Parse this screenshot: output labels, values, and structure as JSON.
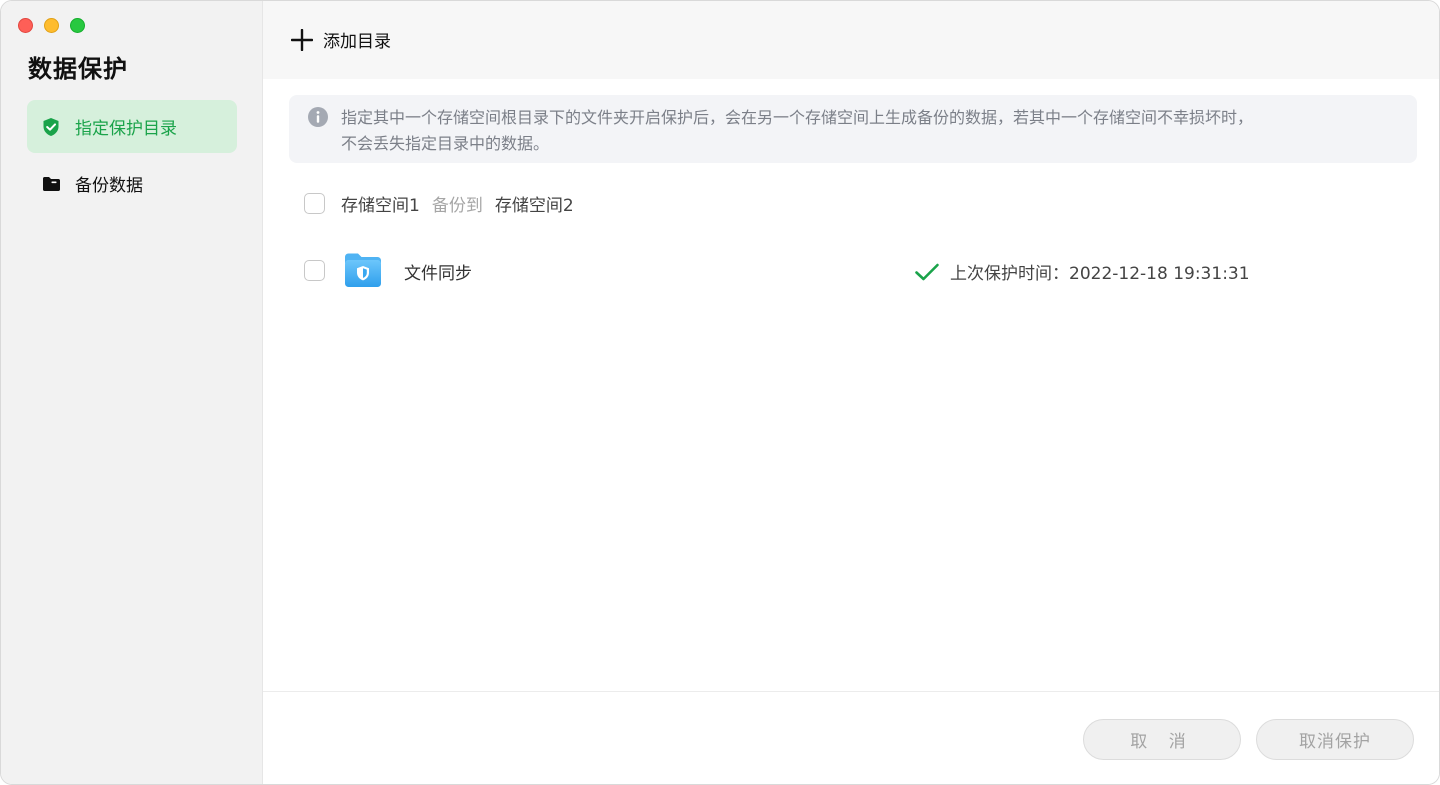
{
  "sidebar": {
    "title": "数据保护",
    "items": [
      {
        "label": "指定保护目录",
        "icon": "shield-check-icon",
        "active": true
      },
      {
        "label": "备份数据",
        "icon": "folder-icon",
        "active": false
      }
    ]
  },
  "toolbar": {
    "add_label": "添加目录"
  },
  "info": {
    "text_line1": "指定其中一个存储空间根目录下的文件夹开启保护后，会在另一个存储空间上生成备份的数据，若其中一个存储空间不幸损坏时，",
    "text_line2": "不会丢失指定目录中的数据。"
  },
  "pair": {
    "source": "存储空间1",
    "relation": "备份到",
    "target": "存储空间2"
  },
  "entries": [
    {
      "name": "文件同步",
      "status": "上次保护时间：2022-12-18 19:31:31"
    }
  ],
  "footer": {
    "cancel_label": "取 消",
    "unprotect_label": "取消保护"
  },
  "colors": {
    "accent_green": "#1aa34a",
    "active_bg": "#d6f0dc",
    "folder_blue": "#3aa8f0"
  }
}
